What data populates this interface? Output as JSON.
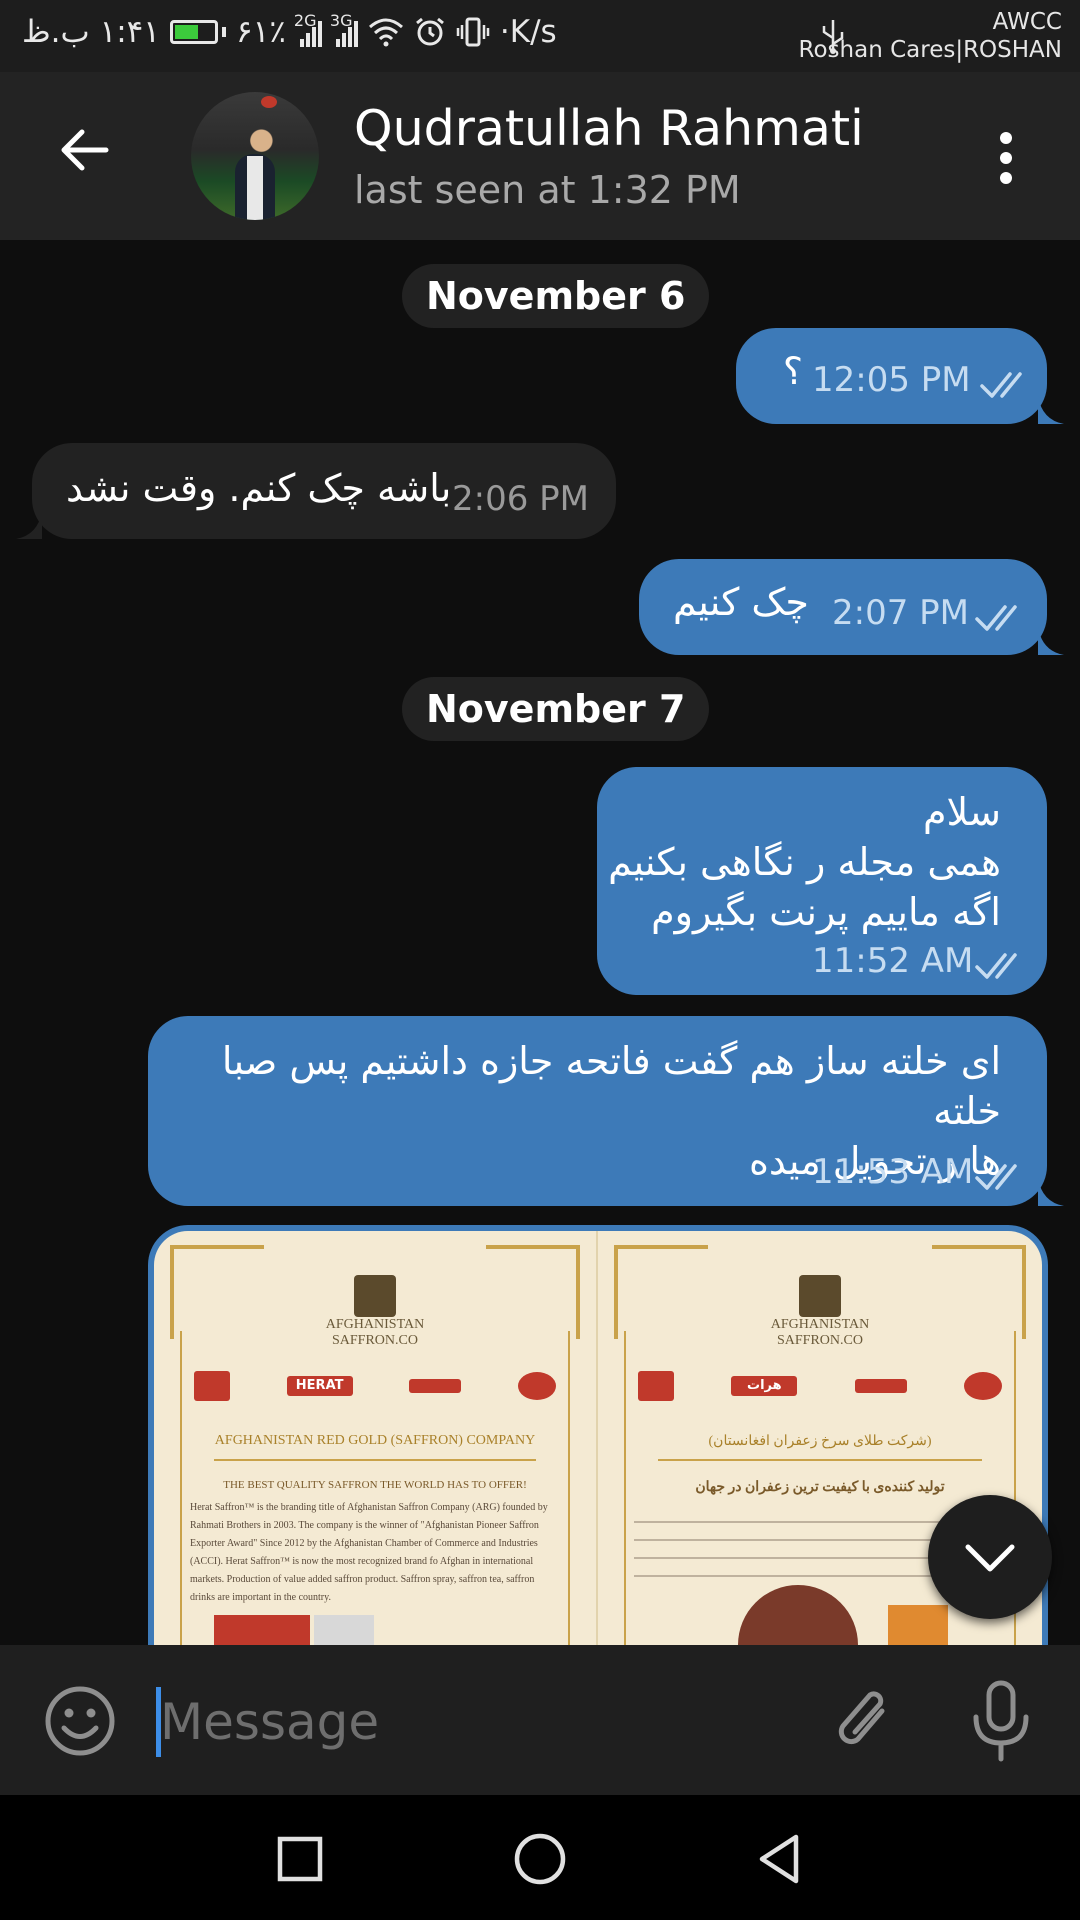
{
  "status_bar": {
    "time": "۱:۴۱ ب.ظ",
    "battery": "۶۱٪",
    "battery_level": 0.61,
    "net_1": "2G",
    "net_2": "3G",
    "speed": "·K/s",
    "carrier_1": "AWCC",
    "carrier_2": "Roshan Cares|ROSHAN"
  },
  "header": {
    "name": "Qudratullah Rahmati",
    "status": "last seen at 1:32 PM"
  },
  "dates": [
    "November 6",
    "November 7"
  ],
  "messages": [
    {
      "dir": "out",
      "text": "؟",
      "time": "12:05 PM"
    },
    {
      "dir": "in",
      "text": "باشه چک کنم. وقت نشد",
      "time": "2:06 PM"
    },
    {
      "dir": "out",
      "text": "چک کنیم",
      "time": "2:07 PM"
    },
    {
      "dir": "out",
      "lines": [
        "سلام",
        "همی مجله ر نگاهی بکنیم",
        "اگه ماییم پرنت بگیروم"
      ],
      "time": "11:52 AM"
    },
    {
      "dir": "out",
      "lines": [
        "ای خلته ساز هم گفت فاتحه جازه داشتیم پس صبا خلته",
        "ها ر تحویل میده"
      ],
      "time": "11:53 AM"
    }
  ],
  "image_message": {
    "left_poster": {
      "logo_line_1": "AFGHANISTAN",
      "logo_line_2": "SAFFRON.CO",
      "brand_1": "HERAT",
      "heading": "AFGHANISTAN RED GOLD (SAFFRON) COMPANY",
      "subheading": "THE BEST QUALITY SAFFRON THE WORLD HAS TO OFFER!",
      "paragraph": "Herat Saffron™ is the branding title of Afghanistan Saffron Company (ARG) founded by Rahmati Brothers in 2003. The company is the winner of \"Afghanistan Pioneer Saffron Exporter Award\" Since 2012 by the Afghanistan Chamber of Commerce and Industries (ACCI). Herat Saffron™ is now the most recognized brand fo Afghan in international markets. Production of value added saffron product. Saffron spray, saffron tea, saffron drinks are important in the country."
    },
    "right_poster": {
      "logo_line_1": "AFGHANISTAN",
      "logo_line_2": "SAFFRON.CO",
      "brand_1": "هرات",
      "heading": "(شرکت طلای سرخ زعفران افغانستان)",
      "subheading": "تولید کننده‌ی با کیفیت ترین زعفران در جهان"
    }
  },
  "input": {
    "placeholder": "Message"
  },
  "colors": {
    "outgoing": "#3d7ab8",
    "incoming": "#222222",
    "background": "#0e0e0e",
    "accent": "#3d8ee8"
  },
  "icons": [
    "back-arrow-icon",
    "more-vertical-icon",
    "double-check-icon",
    "chevron-down-icon",
    "emoji-icon",
    "attach-icon",
    "microphone-icon",
    "nav-recents-icon",
    "nav-home-icon",
    "nav-back-icon",
    "usb-icon",
    "wifi-icon",
    "alarm-icon",
    "vibrate-icon"
  ]
}
